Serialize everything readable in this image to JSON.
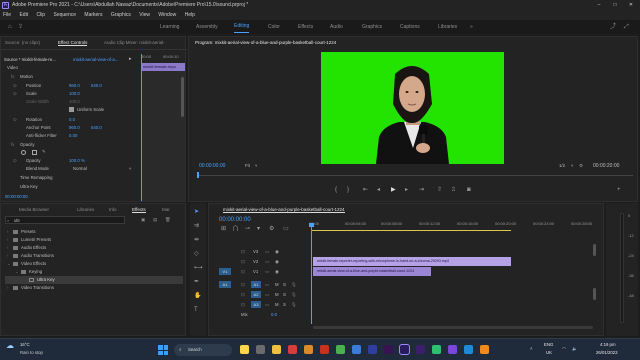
{
  "app": {
    "title": "Adobe Premiere Pro 2021 - C:\\Users\\Abdullah Nawaz\\Documents\\Adobe\\Premiere Pro\\15.0\\sound.prproj *"
  },
  "menu": [
    "File",
    "Edit",
    "Clip",
    "Sequence",
    "Markers",
    "Graphics",
    "View",
    "Window",
    "Help"
  ],
  "workspaces": [
    "Learning",
    "Assembly",
    "Editing",
    "Color",
    "Effects",
    "Audio",
    "Graphics",
    "Captions",
    "Libraries"
  ],
  "effect_panel": {
    "tabs": [
      "Source: (no clips)",
      "Effect Controls",
      "Audio Clip Mixer: mixkit-aerial-"
    ],
    "source_label": "Source * mixkit-female-re...",
    "seq_label": "mixkit-aerial-view-of-a...",
    "video_label": "Video",
    "timecodes": [
      "00:00",
      "00:00:10"
    ],
    "clip_label": "mixkit-female-repo",
    "motion": "Motion",
    "position": {
      "label": "Position",
      "x": "960.0",
      "y": "540.0"
    },
    "scale": {
      "label": "Scale",
      "value": "100.0"
    },
    "scale_width": {
      "label": "Scale Width",
      "value": "100.0"
    },
    "uniform": "Uniform Scale",
    "rotation": {
      "label": "Rotation",
      "value": "0.0"
    },
    "anchor": {
      "label": "Anchor Point",
      "x": "960.0",
      "y": "540.0"
    },
    "antiflicker": {
      "label": "Anti-flicker Filter",
      "value": "0.00"
    },
    "opacity_section": "Opacity",
    "opacity": {
      "label": "Opacity",
      "value": "100.0 %"
    },
    "blend": {
      "label": "Blend Mode",
      "value": "Normal"
    },
    "time_remap": "Time Remapping",
    "ultra_key": "Ultra Key",
    "timecode": "00:00:00:00"
  },
  "program": {
    "title": "Program: mixkit-aerial-view-of-a-blue-and-purple-basketball-court-1224",
    "timecode_left": "00:00:00:00",
    "fit": "Fit",
    "ratio": "1/2",
    "timecode_right": "00:00:20:00"
  },
  "effects_panel": {
    "tabs": [
      "Media Browser",
      "Libraries",
      "Info",
      "Effects",
      "Mar"
    ],
    "search": "ultr",
    "folders": [
      "Presets",
      "Lumetri Presets",
      "Audio Effects",
      "Audio Transitions",
      "Video Effects",
      "Keying",
      "Ultra Key",
      "Video Transitions"
    ]
  },
  "timeline": {
    "tab": "mixkit-aerial-view-of-a-blue-and-purple-basketball-court-1224",
    "timecode": "00:00:00:00",
    "ruler": [
      "00:00",
      "00:00:04:00",
      "00:00:08:00",
      "00:00:12:00",
      "00:00:16:00",
      "00:00:20:00",
      "00:00:24:00",
      "00:00:28:00"
    ],
    "tracks_video": [
      "V3",
      "V2",
      "V1"
    ],
    "tracks_audio": [
      "A1",
      "A2",
      "A3"
    ],
    "mix": {
      "label": "Mix",
      "value": "0.0"
    },
    "clip_v2": "mixkit-female-reporter-reporting-with-microphone-in-hand-on-a-chroma-29293.mp4",
    "clip_v1": "mixkit-aerial-view-of-a-blue-and-purple-basketball-court-1224",
    "src_v1": "V1",
    "src_a1": "A1",
    "m_label": "M",
    "s_label": "S"
  },
  "taskbar": {
    "weather_temp": "16°C",
    "weather_text": "Rain to stop",
    "search": "Search",
    "lang": "ENG",
    "region": "UK",
    "time": "4:19 pm",
    "date": "26/01/2023"
  },
  "colors": {
    "accent": "#2d8ceb",
    "green_screen": "#22e400",
    "clip_v2": "#b5a2e6",
    "clip_v1": "#9b86d6"
  }
}
